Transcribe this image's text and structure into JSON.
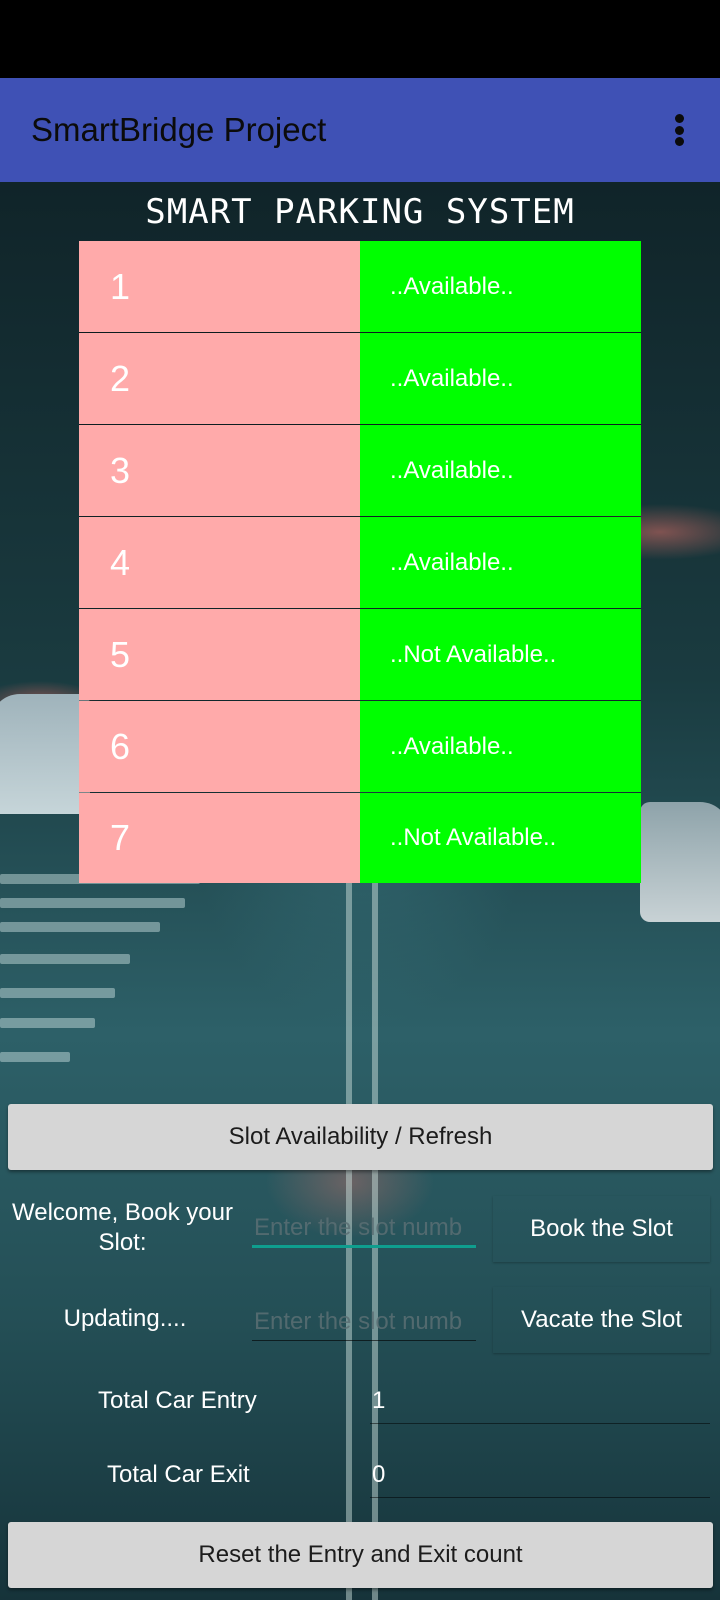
{
  "app_bar": {
    "title": "SmartBridge Project",
    "menu_icon": "more-vert-icon"
  },
  "system_title": "SMART PARKING SYSTEM",
  "slots": [
    {
      "number": "1",
      "status": "..Available.."
    },
    {
      "number": "2",
      "status": "..Available.."
    },
    {
      "number": "3",
      "status": "..Available.."
    },
    {
      "number": "4",
      "status": "..Available.."
    },
    {
      "number": "5",
      "status": "..Not Available.."
    },
    {
      "number": "6",
      "status": "..Available.."
    },
    {
      "number": "7",
      "status": "..Not Available.."
    }
  ],
  "colors": {
    "app_bar": "#3f51b5",
    "slot_number_bg": "#ffaaaa",
    "slot_status_bg": "#00ff00",
    "input_accent": "#0f9e8e"
  },
  "refresh_button": "Slot Availability / Refresh",
  "booking": {
    "welcome_text": "Welcome, Book your Slot:",
    "input_placeholder": "Enter the slot numb",
    "book_button": "Book the Slot"
  },
  "vacate": {
    "status_text": "Updating....",
    "input_placeholder": "Enter the slot numb",
    "vacate_button": "Vacate the Slot"
  },
  "counts": {
    "entry_label": "Total Car Entry",
    "entry_value": "1",
    "exit_label": "Total Car Exit",
    "exit_value": "0"
  },
  "reset_button": "Reset the Entry and Exit count"
}
